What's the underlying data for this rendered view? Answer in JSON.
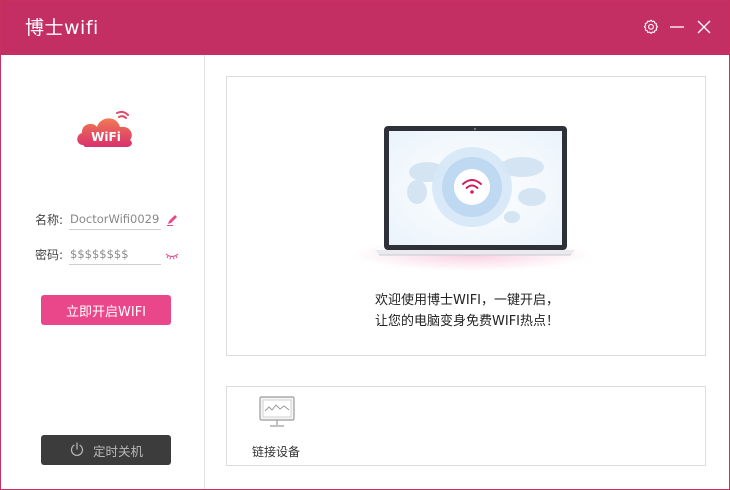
{
  "app": {
    "title": "博士wifi"
  },
  "titlebar": {
    "buttons": [
      "settings-icon",
      "minimize-icon",
      "close-icon"
    ]
  },
  "sidebar": {
    "logo_text": "WiFi",
    "name_label": "名称:",
    "name_value": "DoctorWifi0029",
    "password_label": "密码:",
    "password_value": "$$$$$$$$",
    "start_button": "立即开启WIFI",
    "timer_button": "定时关机"
  },
  "hero": {
    "line1": "欢迎使用博士WIFI，一键开启，",
    "line2": "让您的电脑变身免费WIFI热点！"
  },
  "devices": {
    "label": "链接设备"
  },
  "colors": {
    "brand": "#c42f63",
    "accent": "#e9478a",
    "dark_button": "#3c3c3c"
  }
}
